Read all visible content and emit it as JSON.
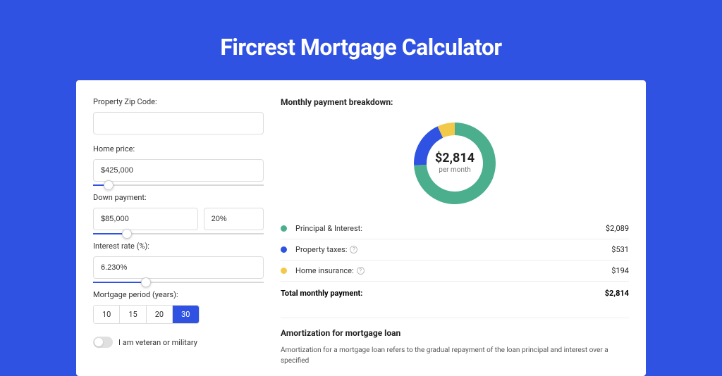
{
  "page": {
    "title": "Fircrest Mortgage Calculator"
  },
  "form": {
    "zip_label": "Property Zip Code:",
    "zip_value": "",
    "home_price_label": "Home price:",
    "home_price_value": "$425,000",
    "home_price_slider_pct": 9,
    "down_payment_label": "Down payment:",
    "down_payment_value": "$85,000",
    "down_payment_pct": "20%",
    "down_payment_slider_pct": 20,
    "interest_label": "Interest rate (%):",
    "interest_value": "6.230%",
    "interest_slider_pct": 31,
    "period_label": "Mortgage period (years):",
    "periods": [
      "10",
      "15",
      "20",
      "30"
    ],
    "period_selected": "30",
    "veteran_label": "I am veteran or military"
  },
  "breakdown": {
    "title": "Monthly payment breakdown:",
    "center_value": "$2,814",
    "center_sub": "per month",
    "items": [
      {
        "label": "Principal & Interest:",
        "value": "$2,089",
        "color": "#4BAF8D",
        "has_info": false,
        "num": 2089
      },
      {
        "label": "Property taxes:",
        "value": "$531",
        "color": "#3052E3",
        "has_info": true,
        "num": 531
      },
      {
        "label": "Home insurance:",
        "value": "$194",
        "color": "#F3C94A",
        "has_info": true,
        "num": 194
      }
    ],
    "total_label": "Total monthly payment:",
    "total_value": "$2,814"
  },
  "chart_data": {
    "type": "pie",
    "title": "Monthly payment breakdown",
    "categories": [
      "Principal & Interest",
      "Property taxes",
      "Home insurance"
    ],
    "values": [
      2089,
      531,
      194
    ],
    "colors": [
      "#4BAF8D",
      "#3052E3",
      "#F3C94A"
    ],
    "total": 2814,
    "center_label": "$2,814 per month"
  },
  "amortization": {
    "title": "Amortization for mortgage loan",
    "body": "Amortization for a mortgage loan refers to the gradual repayment of the loan principal and interest over a specified"
  }
}
